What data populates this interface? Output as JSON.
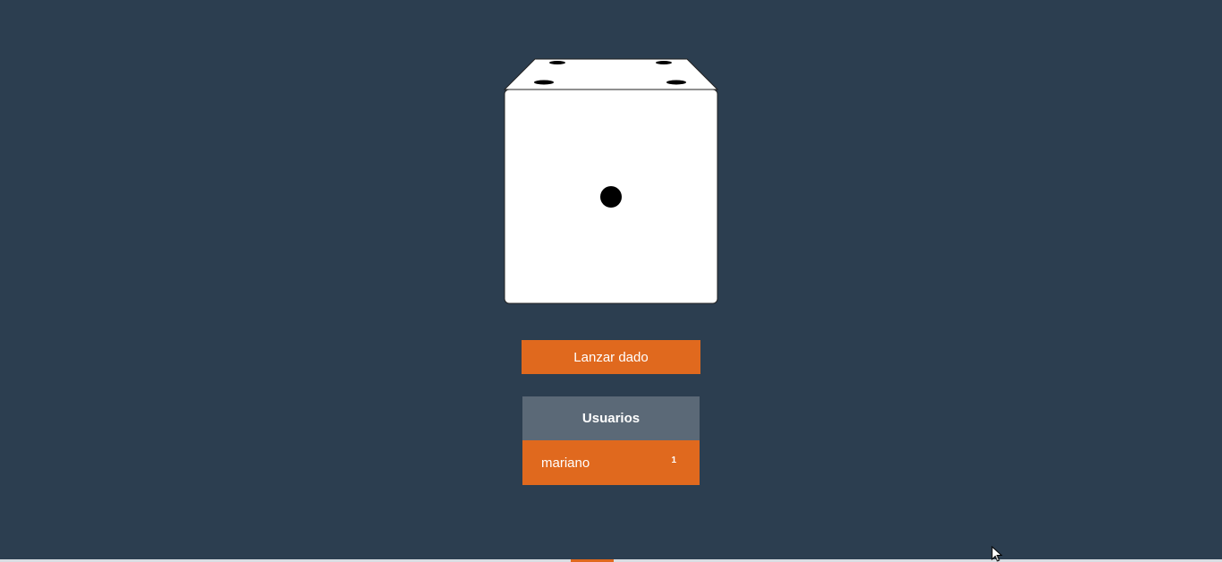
{
  "dice": {
    "front_face_value": 1,
    "top_face_value": 4,
    "face_color": "#ffffff",
    "pip_color": "#000000"
  },
  "controls": {
    "roll_label": "Lanzar dado"
  },
  "users_panel": {
    "title": "Usuarios",
    "users": [
      {
        "name": "mariano",
        "score": "1"
      }
    ]
  },
  "colors": {
    "background": "#2c3e50",
    "accent": "#e0691e",
    "panel_header": "#5b6977"
  }
}
